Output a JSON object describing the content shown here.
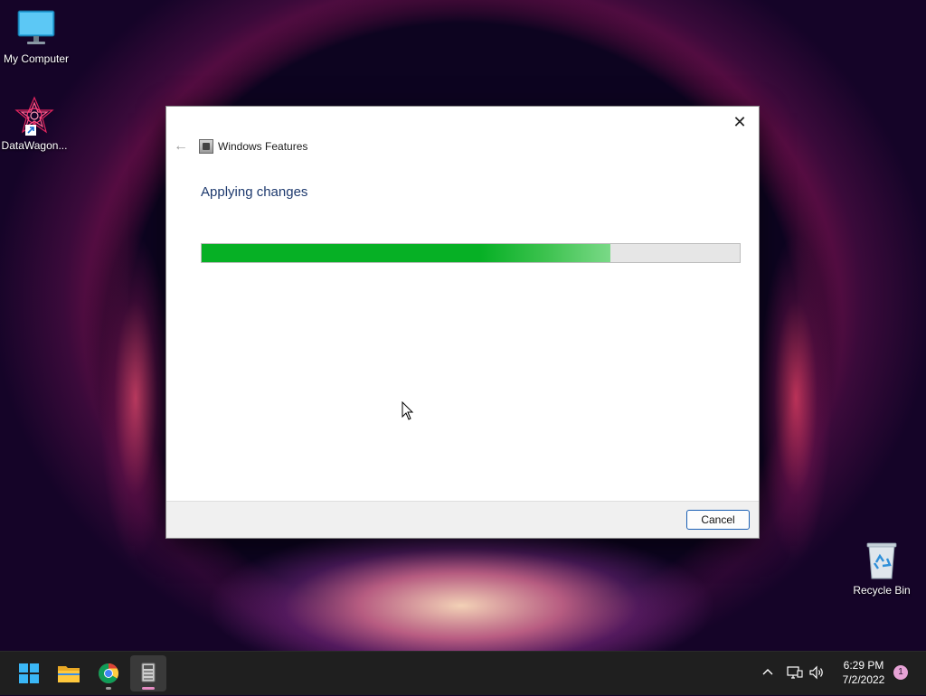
{
  "desktop": {
    "icons": [
      {
        "label": "My Computer",
        "icon": "monitor-icon"
      },
      {
        "label": "DataWagon...",
        "icon": "datawagon-icon"
      },
      {
        "label": "Recycle Bin",
        "icon": "recycle-bin-icon"
      }
    ]
  },
  "dialog": {
    "title": "Windows Features",
    "heading": "Applying changes",
    "progress": 0.76,
    "cancel_label": "Cancel",
    "close_glyph": "✕",
    "back_glyph": "←"
  },
  "taskbar": {
    "apps": [
      {
        "name": "start",
        "icon": "windows-start-icon"
      },
      {
        "name": "file-explorer",
        "icon": "folder-icon"
      },
      {
        "name": "chrome",
        "icon": "chrome-icon"
      },
      {
        "name": "windows-features",
        "icon": "windows-features-icon",
        "active": true
      }
    ],
    "tray": {
      "chevron": "^",
      "time": "6:29 PM",
      "date": "7/2/2022",
      "notification_count": "1"
    }
  },
  "colors": {
    "progress_green": "#06b025",
    "heading_blue": "#1e3a6e",
    "accent_blue": "#1a5fb4"
  }
}
